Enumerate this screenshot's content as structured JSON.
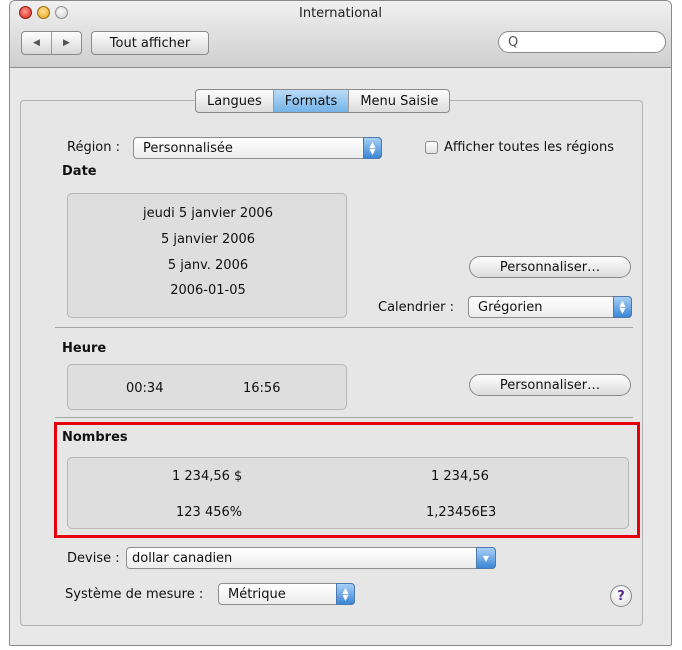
{
  "window": {
    "title": "International"
  },
  "toolbar": {
    "back_glyph": "◀",
    "forward_glyph": "▶",
    "show_all": "Tout afficher",
    "search_placeholder": "",
    "search_glyph": "Q"
  },
  "tabs": [
    {
      "label": "Langues",
      "active": false
    },
    {
      "label": "Formats",
      "active": true
    },
    {
      "label": "Menu Saisie",
      "active": false
    }
  ],
  "region": {
    "label": "Région :",
    "value": "Personnalisée",
    "show_all_label": "Afficher toutes les régions",
    "show_all_checked": false
  },
  "date": {
    "heading": "Date",
    "samples": [
      "jeudi 5 janvier 2006",
      "5 janvier 2006",
      "5 janv. 2006",
      "2006-01-05"
    ],
    "customize": "Personnaliser…",
    "calendar_label": "Calendrier :",
    "calendar_value": "Grégorien"
  },
  "time": {
    "heading": "Heure",
    "short": "00:34",
    "long": "16:56",
    "customize": "Personnaliser…"
  },
  "numbers": {
    "heading": "Nombres",
    "currency_sample": "1 234,56 $",
    "decimal_sample": "1 234,56",
    "percent_sample": "123 456%",
    "scientific_sample": "1,23456E3"
  },
  "currency": {
    "label": "Devise :",
    "value": "dollar canadien"
  },
  "measure": {
    "label": "Système de mesure :",
    "value": "Métrique"
  },
  "help": {
    "glyph": "?"
  },
  "colors": {
    "highlight": "#e6000d",
    "tab_active": "#74b3e6",
    "popup_arrow": "#3b86d6"
  },
  "popup_arrows": {
    "up": "▲",
    "down": "▼"
  }
}
